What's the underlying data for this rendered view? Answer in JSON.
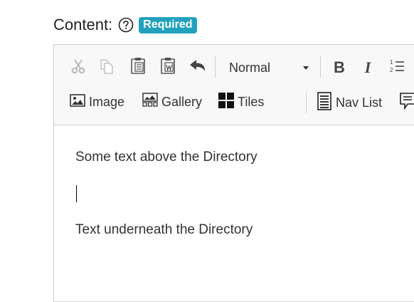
{
  "field": {
    "label": "Content:",
    "help_icon": "question-circle-icon",
    "required_badge": "Required",
    "badge_color": "#22a1bd"
  },
  "toolbar": {
    "row1": {
      "cut_icon": "scissors-icon",
      "copy_icon": "copy-icon",
      "paste_icon": "clipboard-icon",
      "paste_word_icon": "clipboard-word-icon",
      "undo_icon": "undo-arrow-icon",
      "format_value": "Normal",
      "bold_label": "B",
      "italic_label": "I",
      "numbered_list_icon": "numbered-list-icon"
    },
    "row2": {
      "image_label": "Image",
      "gallery_label": "Gallery",
      "tiles_label": "Tiles",
      "navlist_label": "Nav List",
      "comment_icon": "speech-bubble-icon"
    }
  },
  "content": {
    "paragraph1": "Some text above the Directory",
    "paragraph2": "Text underneath the Directory"
  }
}
